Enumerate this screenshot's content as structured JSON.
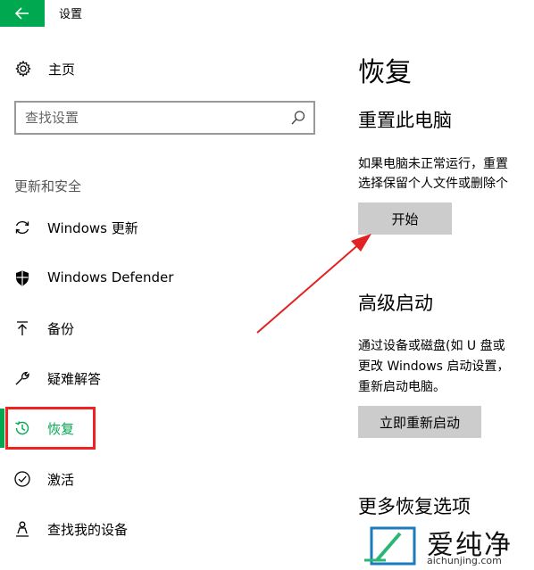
{
  "window": {
    "title": "设置"
  },
  "sidebar": {
    "home_label": "主页",
    "search_placeholder": "查找设置",
    "section_header": "更新和安全",
    "items": [
      {
        "label": "Windows 更新",
        "icon": "refresh-icon"
      },
      {
        "label": "Windows Defender",
        "icon": "shield-icon"
      },
      {
        "label": "备份",
        "icon": "upload-arrow-icon"
      },
      {
        "label": "疑难解答",
        "icon": "wrench-icon"
      },
      {
        "label": "恢复",
        "icon": "history-icon",
        "active": true
      },
      {
        "label": "激活",
        "icon": "checkmark-circle-icon"
      },
      {
        "label": "查找我的设备",
        "icon": "person-pin-icon"
      }
    ]
  },
  "main": {
    "title": "恢复",
    "reset": {
      "heading": "重置此电脑",
      "line1": "如果电脑未正常运行，重置",
      "line2": "选择保留个人文件或删除个",
      "button": "开始"
    },
    "advanced": {
      "heading": "高级启动",
      "line1": "通过设备或磁盘(如 U 盘或",
      "line2": "更改 Windows 启动设置，",
      "line3": "重新启动电脑。",
      "button": "立即重新启动"
    },
    "more": {
      "heading": "更多恢复选项"
    }
  },
  "watermark": {
    "brand": "爱纯净",
    "url": "aichunjing.com"
  },
  "colors": {
    "accent": "#00a950",
    "annotation": "#e22222",
    "button_bg": "#cccccc"
  }
}
